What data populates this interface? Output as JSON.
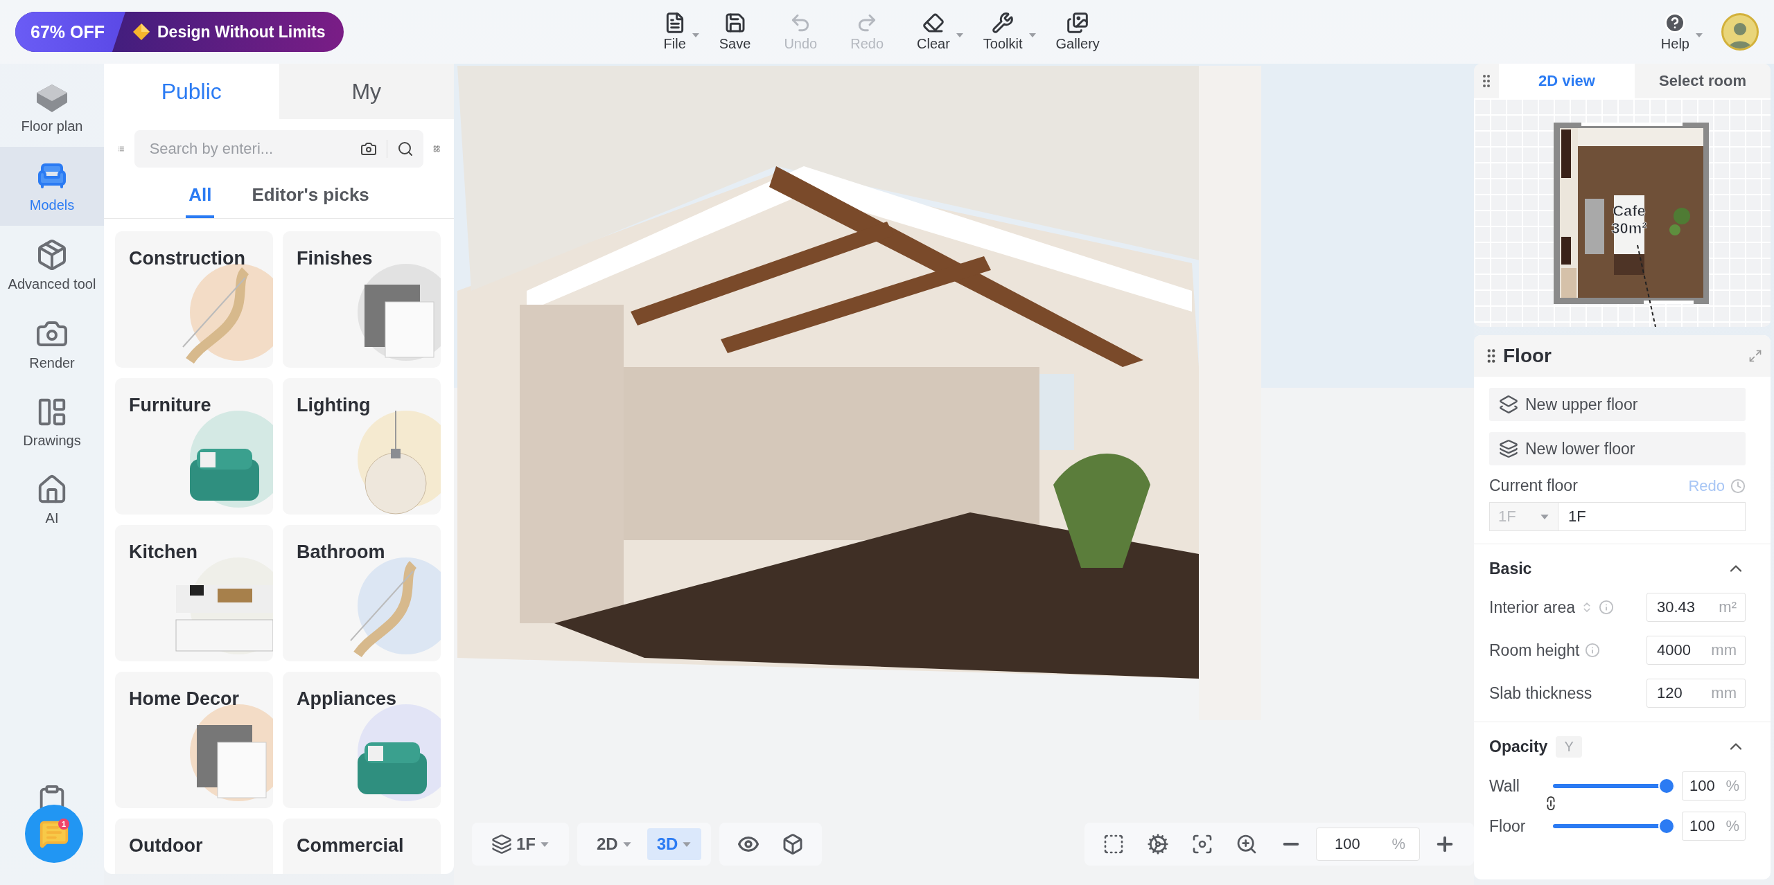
{
  "promo": {
    "discount": "67% OFF",
    "text": "Design Without Limits"
  },
  "toolbar": [
    {
      "kind": "file",
      "label": "File",
      "dropdown": true,
      "disabled": false
    },
    {
      "kind": "save",
      "label": "Save",
      "dropdown": false,
      "disabled": false
    },
    {
      "kind": "undo",
      "label": "Undo",
      "dropdown": false,
      "disabled": true
    },
    {
      "kind": "redo",
      "label": "Redo",
      "dropdown": false,
      "disabled": true
    },
    {
      "kind": "clear",
      "label": "Clear",
      "dropdown": true,
      "disabled": false
    },
    {
      "kind": "toolkit",
      "label": "Toolkit",
      "dropdown": true,
      "disabled": false
    },
    {
      "kind": "gallery",
      "label": "Gallery",
      "dropdown": false,
      "disabled": false
    }
  ],
  "help": {
    "label": "Help",
    "dropdown": true
  },
  "rail": [
    {
      "kind": "floorplan",
      "label": "Floor plan",
      "selected": false
    },
    {
      "kind": "models",
      "label": "Models",
      "selected": true
    },
    {
      "kind": "advanced",
      "label": "Advanced tool",
      "selected": false
    },
    {
      "kind": "render",
      "label": "Render",
      "selected": false
    },
    {
      "kind": "drawings",
      "label": "Drawings",
      "selected": false
    },
    {
      "kind": "ai",
      "label": "AI",
      "selected": false
    }
  ],
  "library": {
    "tabs": [
      {
        "label": "Public",
        "selected": true
      },
      {
        "label": "My",
        "selected": false
      }
    ],
    "search": {
      "placeholder": "Search by enteri..."
    },
    "filters": [
      {
        "label": "All",
        "selected": true
      },
      {
        "label": "Editor's picks",
        "selected": false
      }
    ],
    "categories": [
      {
        "label": "Construction"
      },
      {
        "label": "Finishes"
      },
      {
        "label": "Furniture"
      },
      {
        "label": "Lighting"
      },
      {
        "label": "Kitchen"
      },
      {
        "label": "Bathroom"
      },
      {
        "label": "Home Decor"
      },
      {
        "label": "Appliances"
      },
      {
        "label": "Outdoor"
      },
      {
        "label": "Commercial"
      }
    ]
  },
  "chat": {
    "badge": "1"
  },
  "minimap": {
    "tabs": [
      {
        "label": "2D view",
        "selected": true
      },
      {
        "label": "Select room",
        "selected": false
      }
    ],
    "room": {
      "name": "Cafe",
      "area": "30m²"
    }
  },
  "floor_panel": {
    "title": "Floor",
    "actions": [
      {
        "kind": "upper",
        "label": "New upper floor"
      },
      {
        "kind": "lower",
        "label": "New lower floor"
      }
    ],
    "current_floor": {
      "label": "Current floor",
      "redo": "Redo",
      "select": "1F",
      "value": "1F"
    },
    "basic": {
      "title": "Basic",
      "expanded": true,
      "fields": [
        {
          "label": "Interior area",
          "icons": [
            {
              "kind": "sort"
            },
            {
              "kind": "info"
            }
          ],
          "value": "30.43",
          "unit": "m²"
        },
        {
          "label": "Room height",
          "icons": [
            {
              "kind": "info"
            }
          ],
          "value": "4000",
          "unit": "mm"
        },
        {
          "label": "Slab thickness",
          "value": "120",
          "unit": "mm"
        }
      ]
    },
    "opacity": {
      "title": "Opacity",
      "key": "Y",
      "expanded": true,
      "sliders": [
        {
          "label": "Wall",
          "level": 1,
          "value": "100",
          "unit": "%"
        },
        {
          "label": "Floor",
          "level": 1,
          "value": "100",
          "unit": "%"
        }
      ]
    }
  },
  "view_bar": {
    "floor": "1F",
    "modes": [
      {
        "label": "2D",
        "selected": false
      },
      {
        "label": "3D",
        "selected": true
      }
    ],
    "zoom": {
      "value": "100",
      "unit": "%"
    }
  }
}
